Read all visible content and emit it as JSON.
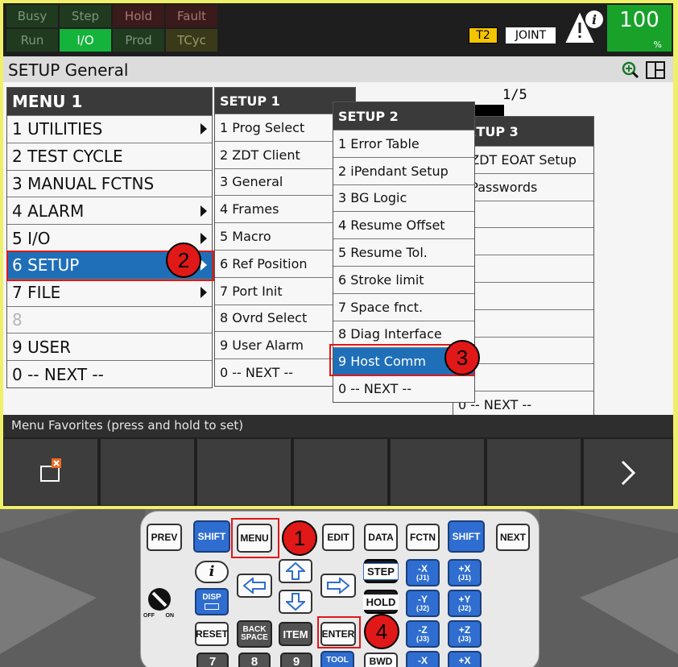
{
  "status_lamps": [
    {
      "label": "Busy",
      "state": "dim-green"
    },
    {
      "label": "Step",
      "state": "dim-green"
    },
    {
      "label": "Hold",
      "state": "dim-red"
    },
    {
      "label": "Fault",
      "state": "dim-red"
    },
    {
      "label": "Run",
      "state": "dim-green"
    },
    {
      "label": "I/O",
      "state": "on-green"
    },
    {
      "label": "Prod",
      "state": "dim-green"
    },
    {
      "label": "TCyc",
      "state": "dim-yellow"
    }
  ],
  "badges": {
    "mode": "T2",
    "coord": "JOINT"
  },
  "override": {
    "value": "100",
    "unit": "%"
  },
  "title": "SETUP General",
  "pager": "1/5",
  "menu1": {
    "header": "MENU  1",
    "items": [
      {
        "label": "1 UTILITIES",
        "arrow": true
      },
      {
        "label": "2 TEST CYCLE",
        "arrow": false
      },
      {
        "label": "3 MANUAL FCTNS",
        "arrow": false
      },
      {
        "label": "4 ALARM",
        "arrow": true
      },
      {
        "label": "5 I/O",
        "arrow": true
      },
      {
        "label": "6 SETUP",
        "arrow": true,
        "selected": true
      },
      {
        "label": "7 FILE",
        "arrow": true
      },
      {
        "label": "8",
        "arrow": false,
        "dim": true
      },
      {
        "label": "9 USER",
        "arrow": false
      },
      {
        "label": "0 -- NEXT --",
        "arrow": false
      }
    ]
  },
  "menu2": {
    "header": "SETUP  1",
    "items": [
      "1 Prog Select",
      "2 ZDT Client",
      "3 General",
      "4 Frames",
      "5 Macro",
      "6 Ref Position",
      "7 Port Init",
      "8 Ovrd Select",
      "9 User Alarm",
      "0 -- NEXT --"
    ]
  },
  "menu3": {
    "header": "SETUP  2",
    "items": [
      "1 Error Table",
      "2 iPendant Setup",
      "3 BG Logic",
      "4 Resume Offset",
      "5 Resume Tol.",
      "6 Stroke limit",
      "7 Space fnct.",
      "8 Diag Interface",
      "9 Host Comm",
      "0 -- NEXT --"
    ],
    "selected_index": 8
  },
  "menu4": {
    "header": "SETUP  3",
    "items": [
      "1 ZDT EOAT Setup",
      "2 Passwords",
      "",
      "",
      "",
      "",
      "",
      "",
      "",
      "0 -- NEXT --"
    ]
  },
  "favorites_label": "Menu Favorites (press and hold to set)",
  "callouts": [
    "1",
    "2",
    "3",
    "4"
  ],
  "pendant_keys": {
    "prev": "PREV",
    "shift": "SHIFT",
    "menu": "MENU",
    "edit": "EDIT",
    "data": "DATA",
    "fctn": "FCTN",
    "next": "NEXT",
    "info": "i",
    "disp": "DISP",
    "step": "STEP",
    "hold": "HOLD",
    "reset": "RESET",
    "backspace": "BACK SPACE",
    "item": "ITEM",
    "enter": "ENTER",
    "tool": "TOOL",
    "bwd": "BWD",
    "nx": "-X",
    "nx_sub": "(J1)",
    "px": "+X",
    "px_sub": "(J1)",
    "ny": "-Y",
    "ny_sub": "(J2)",
    "py": "+Y",
    "py_sub": "(J2)",
    "nz": "-Z",
    "nz_sub": "(J3)",
    "pz": "+Z",
    "pz_sub": "(J3)",
    "n7": "7",
    "n8": "8",
    "n9": "9",
    "switch_off": "OFF",
    "switch_on": "ON"
  },
  "colors": {
    "frame": "#f0ef6a",
    "selected": "#1f6fb8",
    "callout": "#e01818",
    "override": "#18a22a"
  },
  "icons": [
    "warning-info-icon",
    "zoom-icon",
    "split-screen-icon",
    "favorite-add-icon",
    "next-page-icon",
    "arrow-up-icon",
    "arrow-down-icon",
    "arrow-left-icon",
    "arrow-right-icon",
    "key-switch-icon"
  ]
}
